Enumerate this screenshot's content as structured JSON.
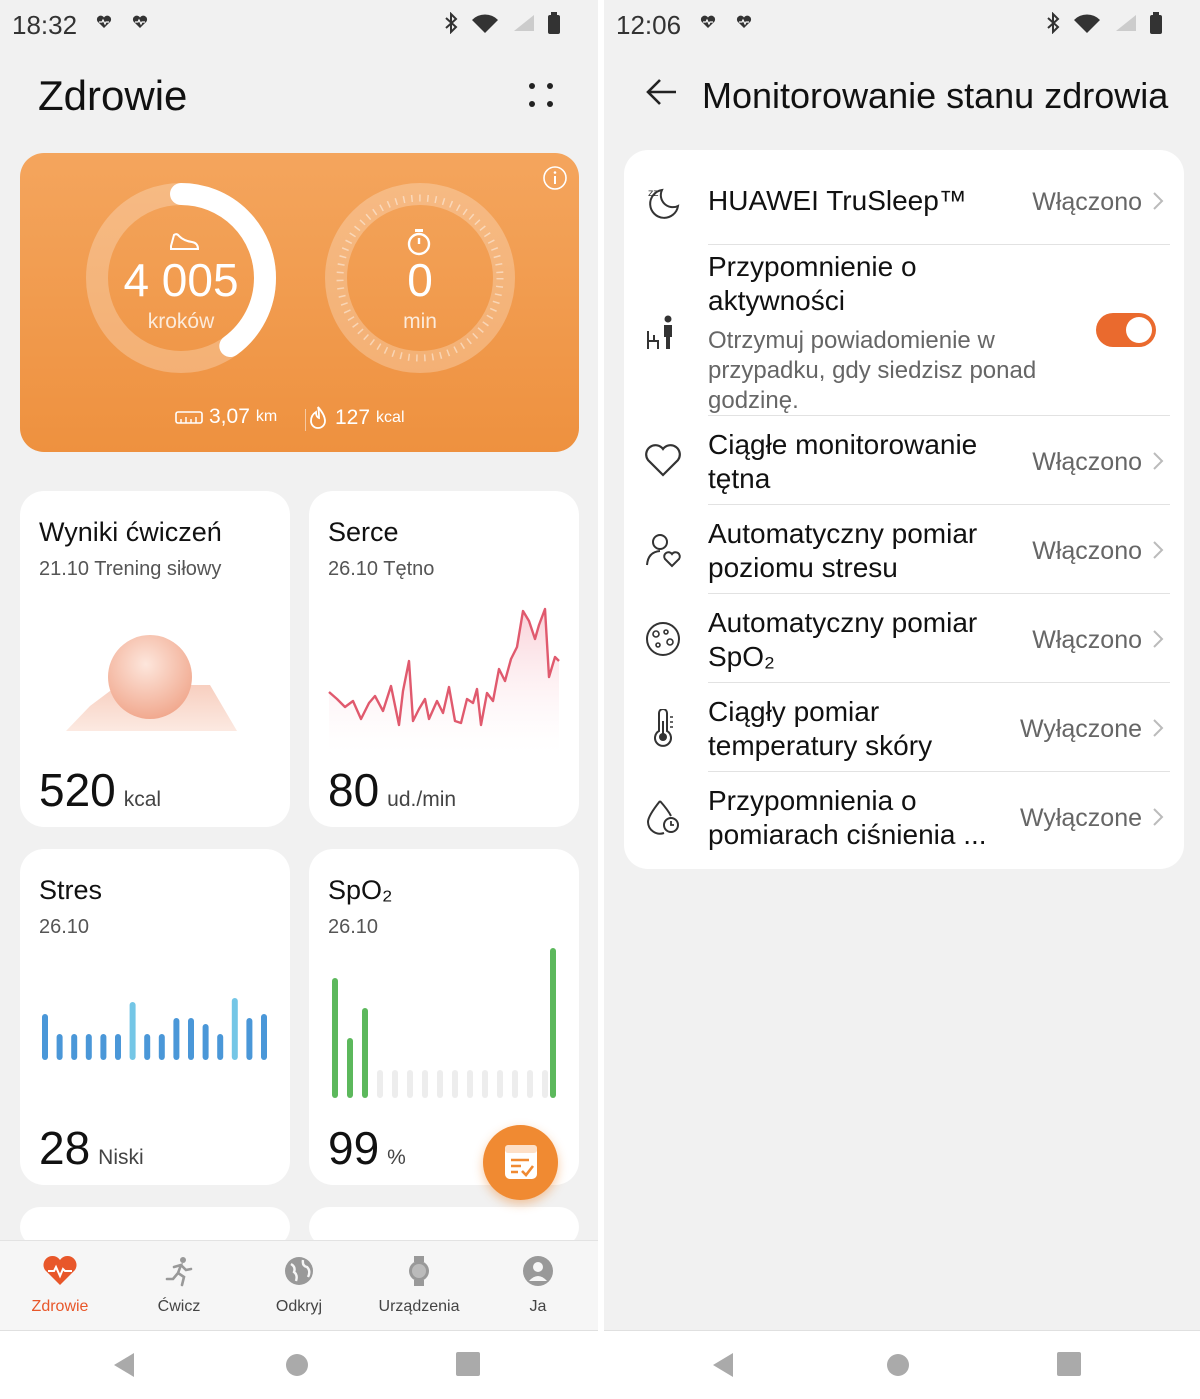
{
  "left": {
    "status": {
      "time": "18:32"
    },
    "title": "Zdrowie",
    "summary": {
      "steps_value": "4 005",
      "steps_label": "kroków",
      "steps_progress": 0.4,
      "active_value": "0",
      "active_label": "min",
      "distance_value": "3,07",
      "distance_unit": "km",
      "calories_value": "127",
      "calories_unit": "kcal"
    },
    "cards": {
      "exercise": {
        "title": "Wyniki ćwiczeń",
        "sub": "21.10 Trening siłowy",
        "value": "520",
        "unit": "kcal"
      },
      "heart": {
        "title": "Serce",
        "sub": "26.10 Tętno",
        "value": "80",
        "unit": "ud./min"
      },
      "stress": {
        "title": "Stres",
        "sub": "26.10",
        "value": "28",
        "unit": "Niski"
      },
      "spo2": {
        "title": "SpO₂",
        "sub": "26.10",
        "value": "99",
        "unit": "%"
      }
    },
    "nav": [
      {
        "label": "Zdrowie",
        "icon": "heart-pulse-icon"
      },
      {
        "label": "Ćwicz",
        "icon": "running-icon"
      },
      {
        "label": "Odkryj",
        "icon": "globe-icon"
      },
      {
        "label": "Urządzenia",
        "icon": "watch-icon"
      },
      {
        "label": "Ja",
        "icon": "person-icon"
      }
    ]
  },
  "right": {
    "status": {
      "time": "12:06"
    },
    "title": "Monitorowanie stanu zdrowia",
    "settings": [
      {
        "label": "HUAWEI TruSleep™",
        "value": "Włączono",
        "icon": "sleep-moon-icon"
      },
      {
        "label_line1": "Przypomnienie o",
        "label_line2": "aktywności",
        "desc_line1": "Otrzymuj powiadomienie w",
        "desc_line2": "przypadku, gdy siedzisz ponad",
        "desc_line3": "godzinę.",
        "toggle": "on",
        "icon": "sitting-person-icon"
      },
      {
        "label_line1": "Ciągłe monitorowanie",
        "label_line2": "tętna",
        "value": "Włączono",
        "icon": "heart-outline-icon"
      },
      {
        "label_line1": "Automatyczny pomiar",
        "label_line2": "poziomu stresu",
        "value": "Włączono",
        "icon": "person-heart-icon"
      },
      {
        "label_line1": "Automatyczny pomiar",
        "label_line2": "SpO₂",
        "value": "Włączono",
        "icon": "spo2-icon"
      },
      {
        "label_line1": "Ciągły pomiar",
        "label_line2": "temperatury skóry",
        "value": "Wyłączone",
        "icon": "thermometer-icon"
      },
      {
        "label_line1": "Przypomnienia o",
        "label_line2": "pomiarach ciśnienia ...",
        "value": "Wyłączone",
        "icon": "blood-drop-clock-icon"
      }
    ]
  },
  "colors": {
    "accent": "#ee913f",
    "toggle_on": "#ea6a2e",
    "heart_line": "#e05a6e",
    "stress_bar": "#4a97d8",
    "stress_bar_light": "#74c6e6",
    "spo2_bar": "#5cb85c"
  }
}
